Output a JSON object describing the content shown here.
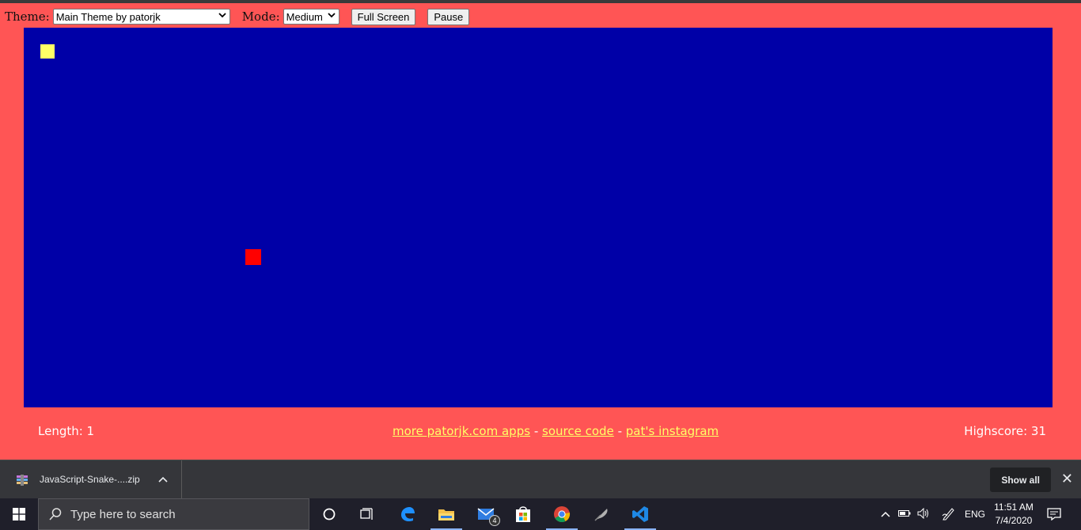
{
  "controls": {
    "theme_label": "Theme:",
    "theme_value": "Main Theme by patorjk",
    "mode_label": "Mode:",
    "mode_value": "Medium",
    "fullscreen_label": "Full Screen",
    "pause_label": "Pause"
  },
  "game": {
    "board_color": "#0000a7",
    "snake_color": "#ffff66",
    "food_color": "#ff0000",
    "length_text": "Length: 1",
    "highscore_text": "Highscore: 31",
    "links": [
      "more patorjk.com apps",
      "source code",
      "pat's instagram"
    ],
    "link_separator": "-"
  },
  "download_bar": {
    "file_name": "JavaScript-Snake-....zip",
    "show_all_label": "Show all"
  },
  "taskbar": {
    "search_placeholder": "Type here to search",
    "mail_badge": "4",
    "language": "ENG",
    "time": "11:51 AM",
    "date": "7/4/2020"
  }
}
